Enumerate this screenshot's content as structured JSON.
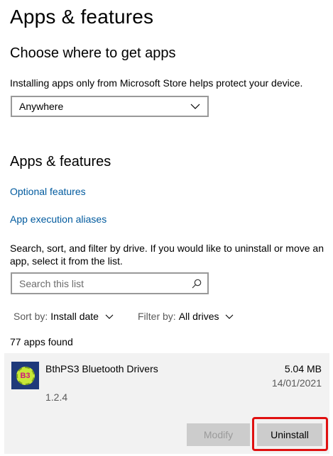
{
  "page": {
    "title": "Apps & features"
  },
  "source_section": {
    "heading": "Choose where to get apps",
    "description": "Installing apps only from Microsoft Store helps protect your device.",
    "dropdown_value": "Anywhere"
  },
  "apps_section": {
    "heading": "Apps & features",
    "links": {
      "optional_features": "Optional features",
      "execution_aliases": "App execution aliases"
    },
    "instructions": "Search, sort, and filter by drive. If you would like to uninstall or move an app, select it from the list.",
    "search": {
      "placeholder": "Search this list"
    },
    "sort": {
      "label": "Sort by:",
      "value": "Install date"
    },
    "filter": {
      "label": "Filter by:",
      "value": "All drives"
    },
    "count_text": "77 apps found"
  },
  "selected_app": {
    "icon_text": "B3",
    "name": "BthPS3 Bluetooth Drivers",
    "size": "5.04 MB",
    "date": "14/01/2021",
    "version": "1.2.4",
    "modify_label": "Modify",
    "uninstall_label": "Uninstall"
  },
  "colors": {
    "link": "#005a9e",
    "card_background": "#f2f2f2",
    "highlight_border": "#e01010",
    "button_background": "#cccccc"
  },
  "icons": [
    "chevron-down-icon",
    "search-icon",
    "app-icon"
  ]
}
